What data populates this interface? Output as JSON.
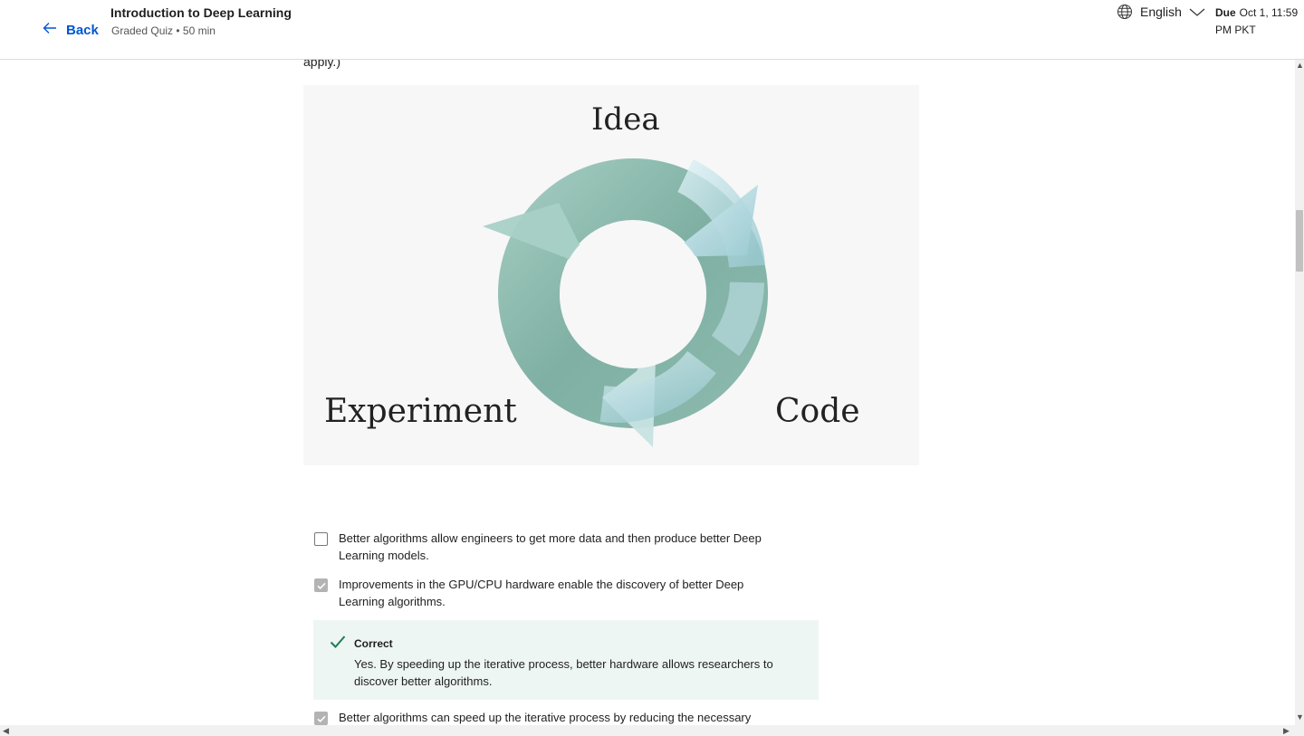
{
  "header": {
    "back_label": "Back",
    "course_title": "Introduction to Deep Learning",
    "course_subtitle": "Graded Quiz • 50 min",
    "language": "English",
    "due_label": "Due",
    "due_value": "Oct 1, 11:59 PM PKT"
  },
  "question": {
    "prev_text": "apply.)",
    "figure": {
      "idea_label": "Idea",
      "experiment_label": "Experiment",
      "code_label": "Code",
      "icon": "iterative-cycle-arrows"
    },
    "options": [
      {
        "text": "Better algorithms allow engineers to get more data and then produce better Deep Learning models.",
        "checked": false
      },
      {
        "text": "Improvements in the GPU/CPU hardware enable the discovery of better Deep Learning algorithms.",
        "checked": true
      },
      {
        "text": "Better algorithms can speed up the iterative process by reducing the necessary",
        "checked": true
      }
    ],
    "feedback": {
      "title": "Correct",
      "text": "Yes. By speeding up the iterative process, better hardware allows researchers to discover better algorithms."
    }
  },
  "colors": {
    "accent": "#0056d2",
    "correct": "#1b7e55",
    "feedback_bg": "#eef6f3"
  }
}
